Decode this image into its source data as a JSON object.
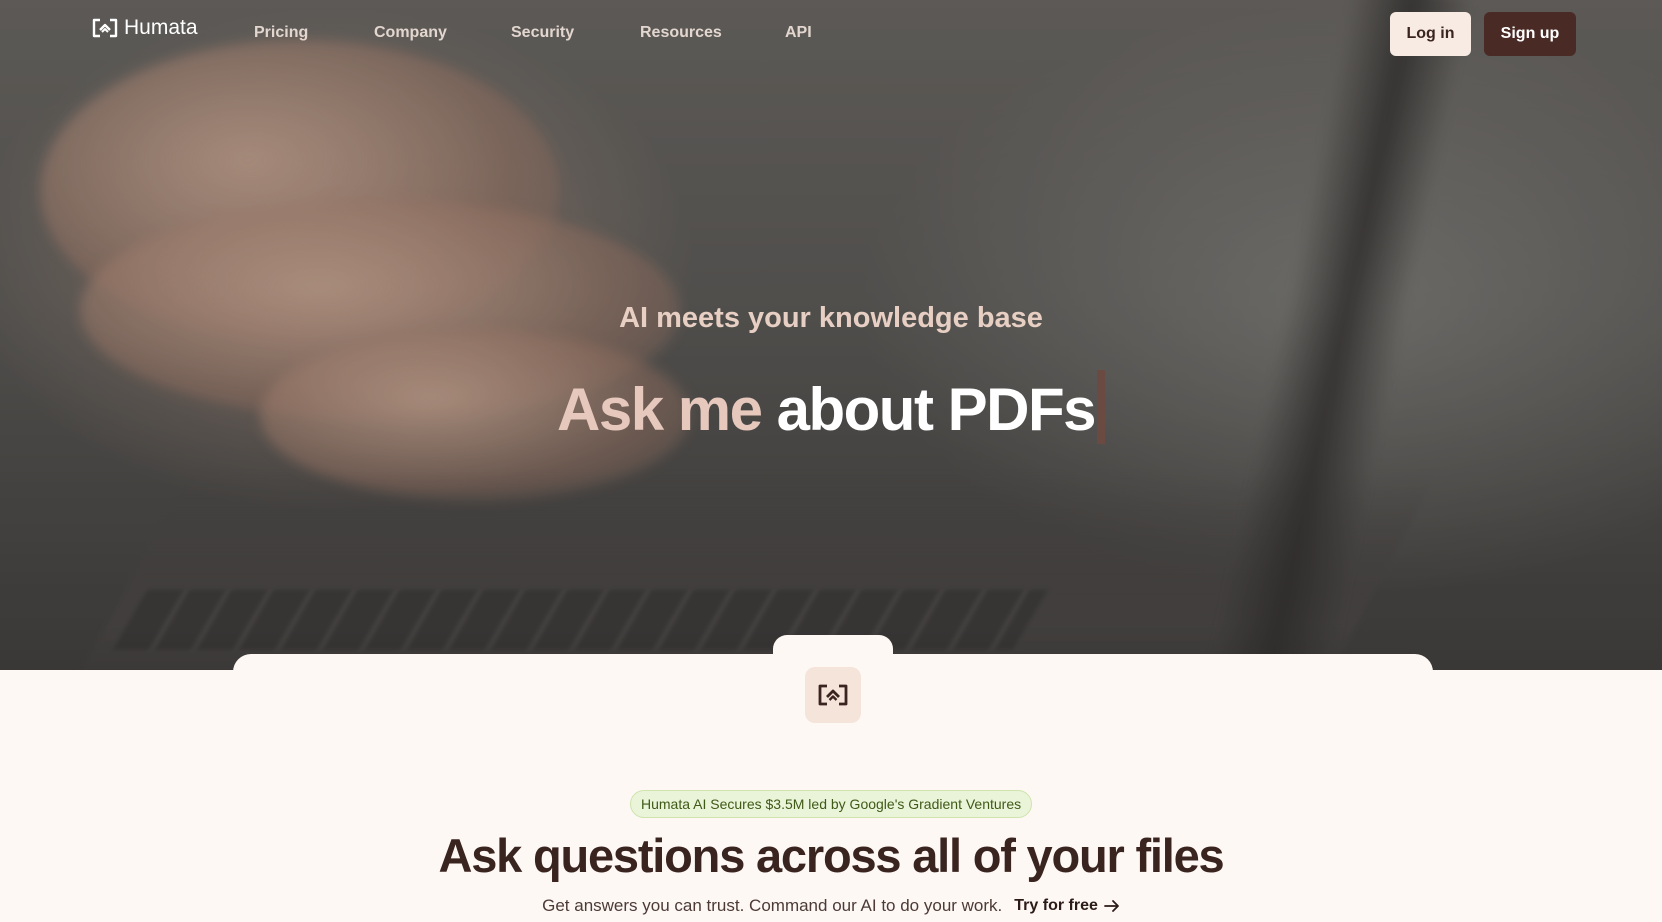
{
  "brand": {
    "name": "Humata",
    "logo_icon": "humata-logo-icon"
  },
  "nav": {
    "links": [
      {
        "label": "Pricing"
      },
      {
        "label": "Company"
      },
      {
        "label": "Security"
      },
      {
        "label": "Resources"
      },
      {
        "label": "API"
      }
    ],
    "login_label": "Log in",
    "signup_label": "Sign up"
  },
  "hero": {
    "subtitle": "AI meets your knowledge base",
    "title_part1": "Ask me",
    "title_part2": "about PDFs"
  },
  "section": {
    "badge": "Humata AI Secures $3.5M led by Google's Gradient Ventures",
    "headline": "Ask questions across all of your files",
    "description": "Get answers you can trust. Command our AI to do your work.",
    "cta_label": "Try for free",
    "cta_icon": "arrow-right-icon"
  },
  "colors": {
    "brand_dark": "#4a2a24",
    "login_bg": "#f7ebe3",
    "page_bg": "#fdf8f4",
    "badge_bg": "#eaf4d8",
    "badge_text": "#3f5a17"
  }
}
